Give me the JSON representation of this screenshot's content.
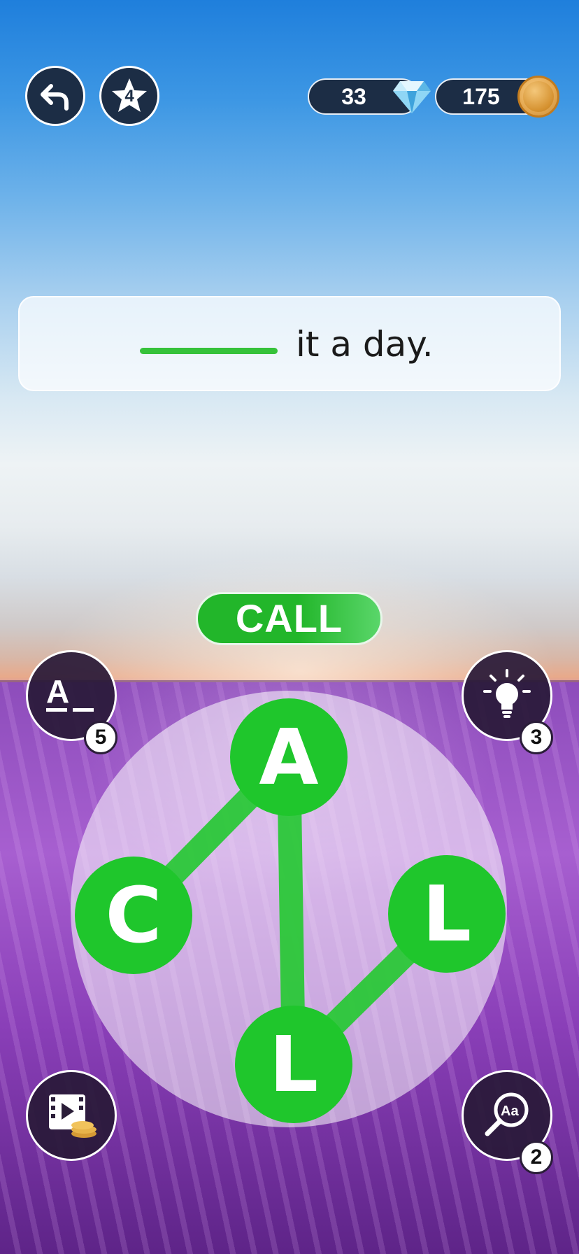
{
  "top_bar": {
    "level_badge": "4",
    "gems": "33",
    "coins": "175"
  },
  "clue": {
    "text": "it a day."
  },
  "current_word": "CALL",
  "wheel": {
    "letters": [
      "A",
      "C",
      "L",
      "L"
    ]
  },
  "powerups": {
    "reveal_letter_count": "5",
    "hint_count": "3",
    "lookup_count": "2"
  },
  "colors": {
    "tile_green": "#1fc62c",
    "badge_navy": "#1c2d45",
    "answer_line_green": "#36c23a"
  }
}
